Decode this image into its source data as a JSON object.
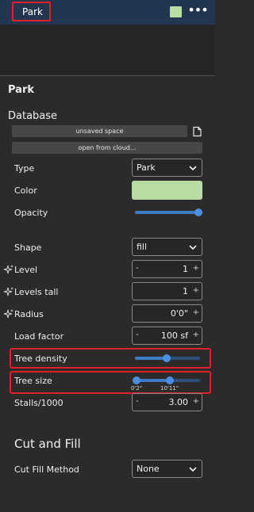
{
  "header": {
    "title": "Park",
    "more": "•••",
    "accent_swatch": "#b8dca2"
  },
  "panel": {
    "title": "Park"
  },
  "database": {
    "title": "Database",
    "unsaved_label": "unsaved space",
    "cloud_label": "open from cloud..."
  },
  "fields": {
    "type": {
      "label": "Type",
      "value": "Park"
    },
    "color": {
      "label": "Color",
      "value": "#b8dca2"
    },
    "opacity": {
      "label": "Opacity",
      "value": 1.0
    },
    "shape": {
      "label": "Shape",
      "value": "fill"
    },
    "level": {
      "label": "Level",
      "value": "1",
      "minus": "-",
      "plus": "+"
    },
    "levels_tall": {
      "label": "Levels tall",
      "value": "1",
      "plus": "+"
    },
    "radius": {
      "label": "Radius",
      "value": "0'0\"",
      "plus": "+"
    },
    "load_factor": {
      "label": "Load factor",
      "value": "100 sf",
      "minus": "-",
      "plus": "+"
    },
    "tree_density": {
      "label": "Tree density",
      "value": 0.5
    },
    "tree_size": {
      "label": "Tree size",
      "min_label": "0'2\"",
      "max_label": "10'11\"",
      "range": [
        0.0,
        0.5
      ]
    },
    "stalls": {
      "label": "Stalls/1000",
      "value": "3.00",
      "minus": "-",
      "plus": "+"
    }
  },
  "cut_fill": {
    "title": "Cut and Fill",
    "method": {
      "label": "Cut Fill Method",
      "value": "None"
    }
  }
}
